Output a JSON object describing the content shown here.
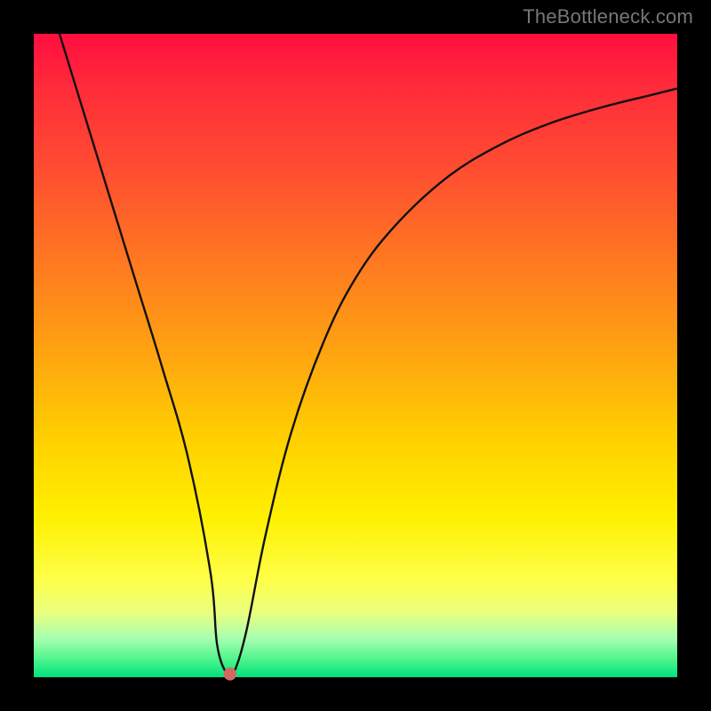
{
  "watermark": "TheBottleneck.com",
  "chart_data": {
    "type": "line",
    "title": "",
    "xlabel": "",
    "ylabel": "",
    "xlim": [
      0,
      100
    ],
    "ylim": [
      0,
      100
    ],
    "grid": false,
    "legend": false,
    "gradient_direction": "vertical",
    "gradient_colors_top_to_bottom": [
      "#ff0e3f",
      "#ff7a20",
      "#ffd000",
      "#feff4a",
      "#00e27b"
    ],
    "series": [
      {
        "name": "curve",
        "color": "#111111",
        "x": [
          4,
          8,
          12,
          16,
          20,
          24,
          27.5,
          28.5,
          30,
          31,
          33,
          36,
          40,
          45,
          50,
          56,
          64,
          72,
          80,
          88,
          96,
          100
        ],
        "y": [
          100,
          87,
          74,
          61,
          48,
          34,
          16,
          5,
          0.5,
          0.5,
          7,
          22,
          38,
          52,
          62,
          70,
          77.5,
          82.5,
          86,
          88.5,
          90.5,
          91.5
        ]
      }
    ],
    "marker": {
      "x": 30.5,
      "y": 0.5,
      "color": "#d06a60",
      "r_percent": 1.0
    }
  }
}
